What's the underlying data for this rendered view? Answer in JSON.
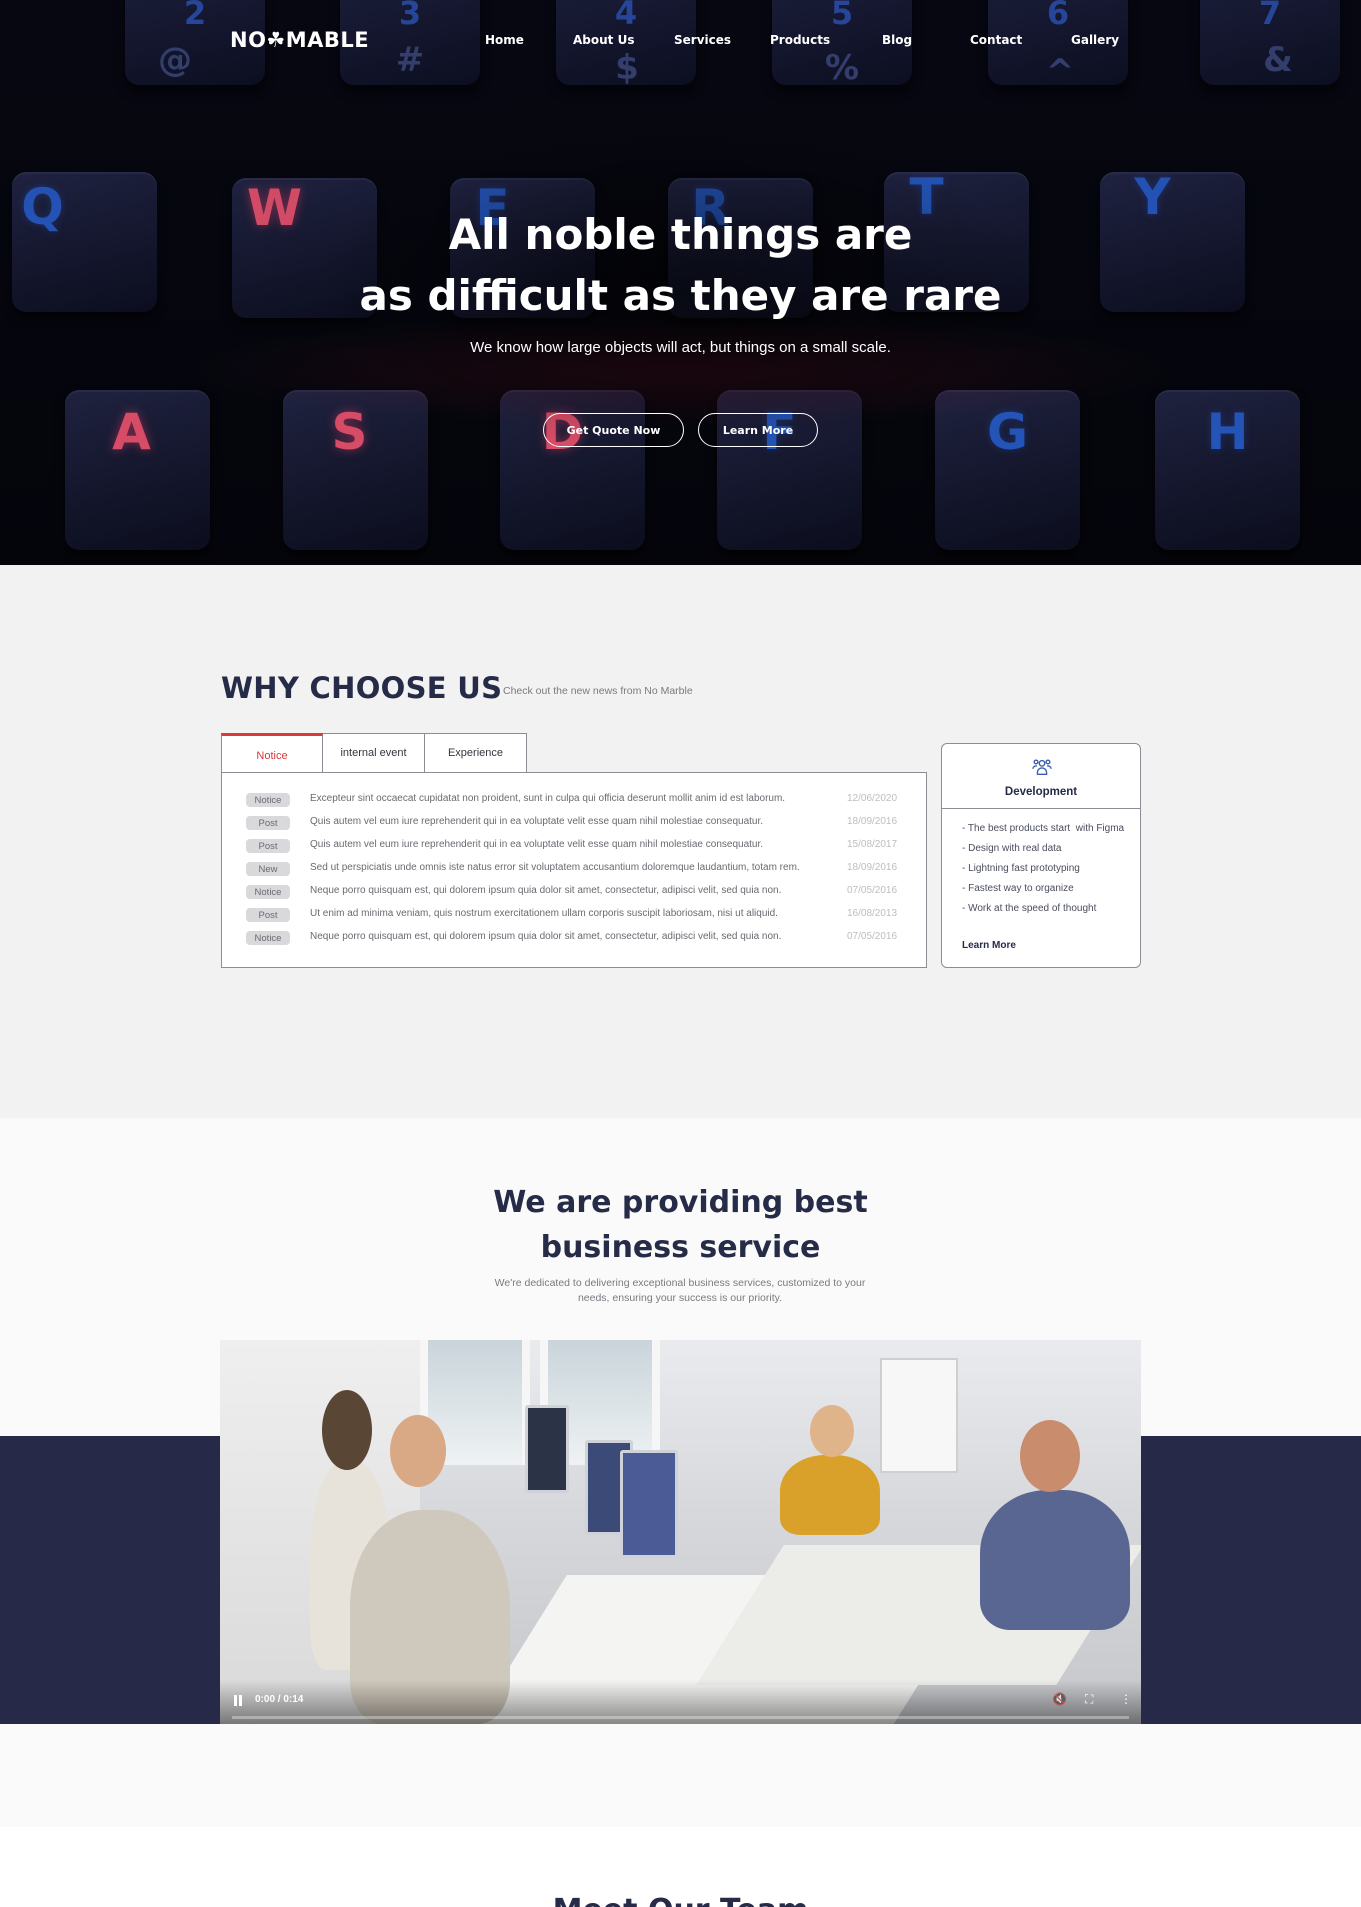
{
  "brand": {
    "logo_text": "NO☘MABLE"
  },
  "nav": {
    "items": [
      "Home",
      "About Us",
      "Services",
      "Products",
      "Blog",
      "Contact",
      "Gallery"
    ]
  },
  "hero": {
    "title_line1": "All noble things are",
    "title_line2": "as difficult as they are rare",
    "subtitle": "We know how large objects will act, but things on a small scale.",
    "primary_button": "Get Quote Now",
    "secondary_button": "Learn More",
    "keys_visible": [
      "2",
      "3",
      "4",
      "5",
      "6",
      "7",
      "@",
      "#",
      "$",
      "%",
      "^",
      "&",
      "Q",
      "W",
      "E",
      "R",
      "T",
      "Y",
      "A",
      "S",
      "D",
      "F",
      "G",
      "H"
    ]
  },
  "why": {
    "title": "WHY CHOOSE US",
    "subtitle": "Check out the new news from No Marble",
    "tabs": [
      "Notice",
      "internal event",
      "Experience"
    ],
    "active_tab": "Notice",
    "rows": [
      {
        "badge": "Notice",
        "text": "Excepteur sint occaecat cupidatat non proident, sunt in culpa qui officia deserunt mollit anim id est laborum.",
        "date": "12/06/2020"
      },
      {
        "badge": "Post",
        "text": "Quis autem vel eum iure reprehenderit qui in ea voluptate velit esse quam nihil molestiae consequatur.",
        "date": "18/09/2016"
      },
      {
        "badge": "Post",
        "text": "Quis autem vel eum iure reprehenderit qui in ea voluptate velit esse quam nihil molestiae consequatur.",
        "date": "15/08/2017"
      },
      {
        "badge": "New",
        "text": "Sed ut perspiciatis unde omnis iste natus error sit voluptatem accusantium doloremque laudantium, totam rem.",
        "date": "18/09/2016"
      },
      {
        "badge": "Notice",
        "text": "Neque porro quisquam est, qui dolorem ipsum quia dolor sit amet, consectetur, adipisci velit, sed quia non.",
        "date": "07/05/2016"
      },
      {
        "badge": "Post",
        "text": "Ut enim ad minima veniam, quis nostrum exercitationem ullam corporis suscipit laboriosam, nisi ut aliquid.",
        "date": "16/08/2013"
      },
      {
        "badge": "Notice",
        "text": "Neque porro quisquam est, qui dolorem ipsum quia dolor sit amet, consectetur, adipisci velit, sed quia non.",
        "date": "07/05/2016"
      }
    ],
    "card": {
      "icon": "users-icon",
      "title": "Development",
      "items": [
        "- The best products start  with Figma",
        "- Design with real data",
        "- Lightning fast prototyping",
        "- Fastest way to organize",
        "- Work at the speed of thought"
      ],
      "link": "Learn More"
    }
  },
  "service": {
    "title_line1": "We are providing best",
    "title_line2": "business service",
    "subtitle": "We're dedicated to delivering exceptional business services, customized to your needs, ensuring your success is our priority.",
    "video": {
      "time": "0:00 / 0:14",
      "progress": 0.0,
      "controls": [
        "pause-icon",
        "mute-icon",
        "fullscreen-icon",
        "more-icon"
      ]
    }
  },
  "team": {
    "title": "Meet Our Team"
  },
  "colors": {
    "navy": "#262a48",
    "accent_red": "#d93a35",
    "section_gray": "#f2f2f2"
  }
}
